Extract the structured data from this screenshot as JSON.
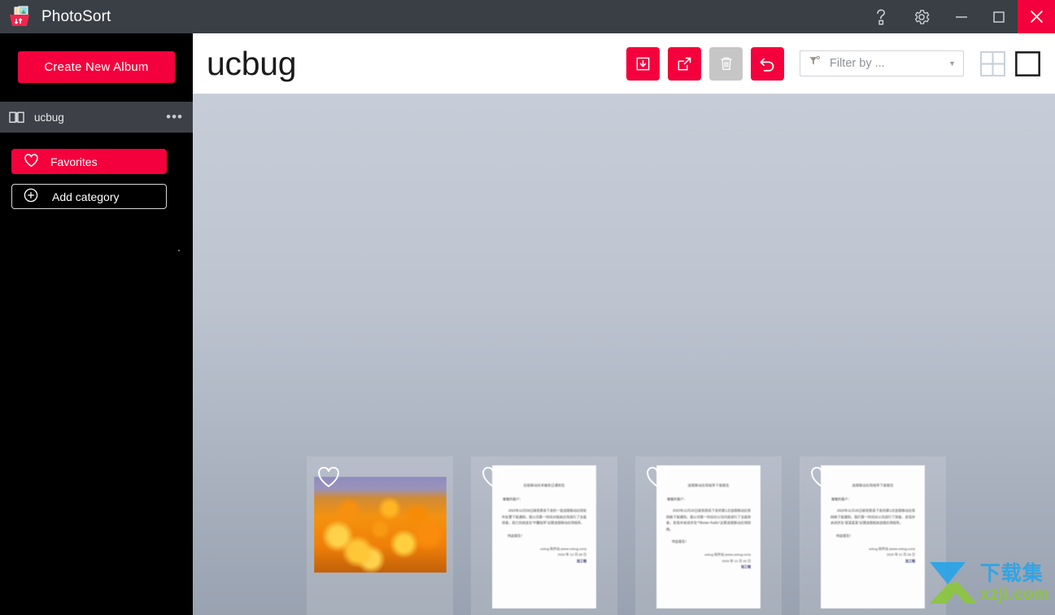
{
  "window": {
    "app_title": "PhotoSort",
    "logo_icon": "photo-basket-sort-icon",
    "controls": [
      {
        "name": "help-button",
        "icon": "question-mark-icon",
        "label": "?"
      },
      {
        "name": "settings-button",
        "icon": "gear-icon",
        "label": ""
      },
      {
        "name": "minimize-button",
        "icon": "minimize-icon",
        "label": ""
      },
      {
        "name": "maximize-button",
        "icon": "maximize-icon",
        "label": ""
      },
      {
        "name": "close-button",
        "icon": "close-icon",
        "label": ""
      }
    ]
  },
  "sidebar": {
    "create_album_label": "Create New Album",
    "album": {
      "icon": "book-icon",
      "name": "ucbug",
      "menu_icon": "ellipsis-icon"
    },
    "categories": [
      {
        "icon": "heart-icon",
        "label": "Favorites",
        "active": true
      },
      {
        "icon": "plus-circle-icon",
        "label": "Add category",
        "active": false
      }
    ]
  },
  "header": {
    "page_title": "ucbug",
    "tools": [
      {
        "name": "import-button",
        "icon": "import-icon",
        "enabled": true,
        "color": "#F4003C"
      },
      {
        "name": "export-button",
        "icon": "export-icon",
        "enabled": true,
        "color": "#F4003C"
      },
      {
        "name": "delete-button",
        "icon": "trash-icon",
        "enabled": false,
        "color": "#c6c6c6"
      },
      {
        "name": "undo-button",
        "icon": "undo-icon",
        "enabled": true,
        "color": "#F4003C"
      }
    ],
    "filter": {
      "icon": "filter-icon",
      "placeholder": "Filter by ...",
      "value": "",
      "caret_icon": "chevron-down-icon"
    },
    "views": [
      {
        "name": "grid-view-button",
        "icon": "grid-icon",
        "active": false
      },
      {
        "name": "single-view-button",
        "icon": "square-icon",
        "active": true
      }
    ]
  },
  "gallery": {
    "background_top": "#c7cdd8",
    "background_bottom": "#99a2b0",
    "items": [
      {
        "type": "photo",
        "favorite_icon": "heart-outline-icon",
        "favorited": false,
        "alt": "orange daisy flowers field"
      },
      {
        "type": "document",
        "favorite_icon": "heart-outline-icon",
        "favorited": false,
        "doc": {
          "title": "远程移动技术服务日通知告",
          "salutation": "尊敬的客户：",
          "body": "2020年12月06日接到贵局下发的一批违规移动应用软件处置下架通知，我公司第一时间对相关应用进行了全面排查，现已完成违法“中署程序”运营违规移动应用程序。",
          "thanks": "特此报告！",
          "signature_site": "ucbug 软件站 (www.ucbug.com)",
          "signature_date": "2020 年 12 月 06 日",
          "stamp": "加工程"
        }
      },
      {
        "type": "document",
        "favorite_icon": "heart-outline-icon",
        "favorited": false,
        "doc": {
          "title": "违规移动应用程序下架报告",
          "salutation": "尊敬的客户：",
          "body": "2020年12月20日接到贵局下发的第1次违规移动应用网络下架通知，我公司第一时间对公司内部进行了全面排查，发现并关闭涉及“Tibetan Radio”运营违规移动应用网络。",
          "thanks": "特此报告！",
          "signature_site": "ucbug 软件站 (www.ucbug.com)",
          "signature_date": "2020 年 12 月 20 日",
          "stamp": "加工程"
        }
      },
      {
        "type": "document",
        "favorite_icon": "heart-outline-icon",
        "favorited": false,
        "doc": {
          "title": "违规移动应用程序下架报告",
          "salutation": "尊敬的客户：",
          "body": "2020年11月26日接到贵局下发的第1次违规移动应用网络下架通知，我们第一时间对公司进行了排查，发现并关闭涉及“某某某某”运营违规相关违规应用程序。",
          "thanks": "特此报告！",
          "signature_site": "ucbug 软件站 (www.ucbug.com)",
          "signature_date": "2020 年 11 月 26 日",
          "stamp": "加工程"
        }
      }
    ],
    "watermark": {
      "icon": "download-arrow-logo",
      "text_cn": "下载集",
      "text_en": "xzji.com"
    }
  }
}
